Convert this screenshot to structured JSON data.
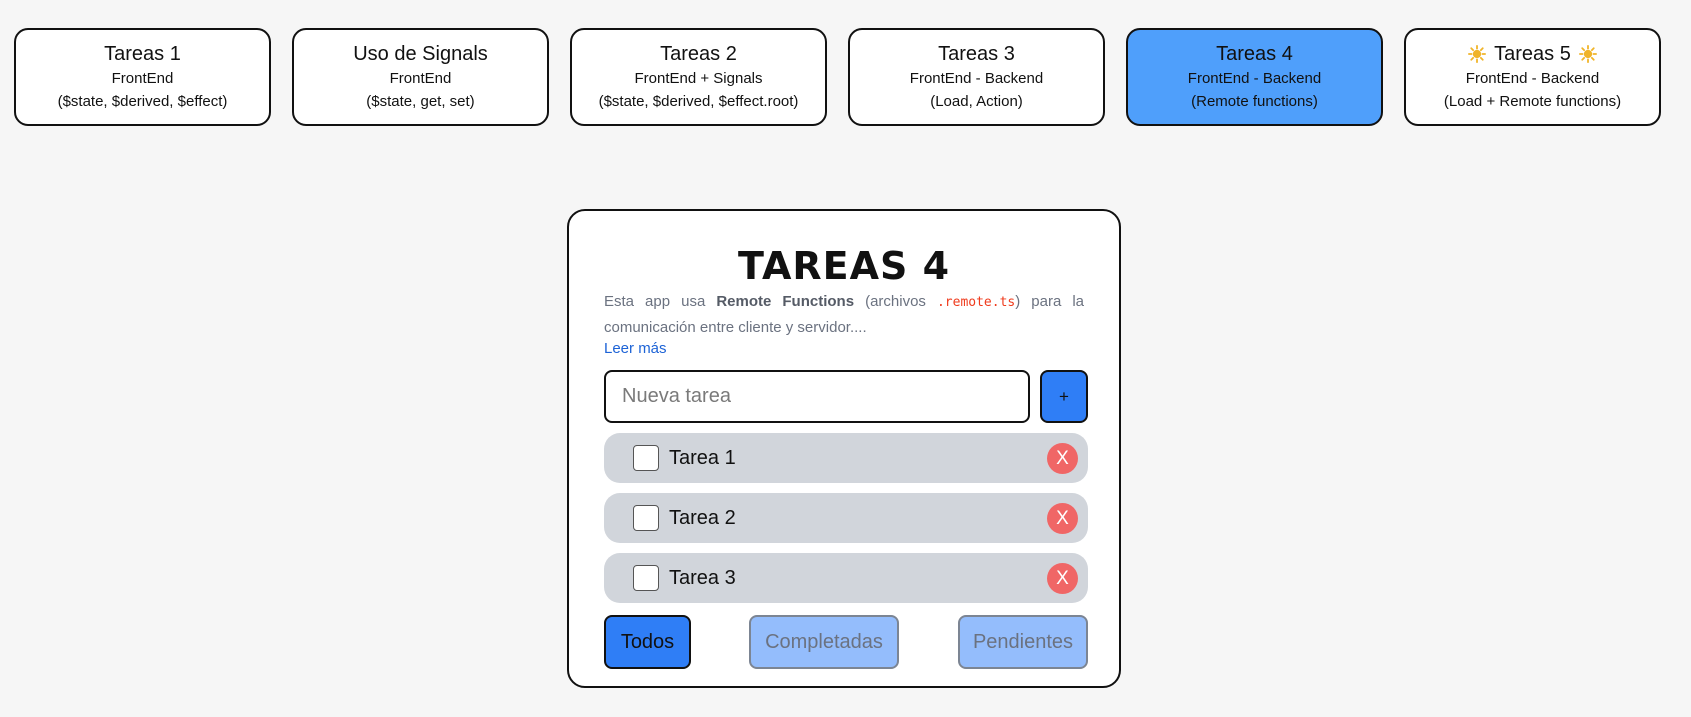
{
  "nav": {
    "cards": [
      {
        "title": "Tareas 1",
        "line1": "FrontEnd",
        "line2": "($state, $derived, $effect)"
      },
      {
        "title": "Uso de Signals",
        "line1": "FrontEnd",
        "line2": "($state, get, set)"
      },
      {
        "title": "Tareas 2",
        "line1": "FrontEnd + Signals",
        "line2": "($state, $derived, $effect.root)"
      },
      {
        "title": "Tareas 3",
        "line1": "FrontEnd - Backend",
        "line2": "(Load, Action)"
      },
      {
        "title": "Tareas 4",
        "line1": "FrontEnd - Backend",
        "line2": "(Remote functions)"
      },
      {
        "title": "Tareas 5",
        "line1": "FrontEnd - Backend",
        "line2": "(Load + Remote functions)"
      }
    ],
    "active_index": 4,
    "accent_color": "#4f9ffb",
    "sun_icon": "sun-icon",
    "sun_color": "#f0b429"
  },
  "panel": {
    "title": "TAREAS 4",
    "description": {
      "part1": "Esta app usa ",
      "bold": "Remote Functions",
      "part2": " (archivos ",
      "code": ".remote.ts",
      "part3": ") para la comunicación entre cliente y servidor...."
    },
    "read_more": "Leer más",
    "input": {
      "value": "",
      "placeholder": "Nueva tarea"
    },
    "add_label": "+",
    "tasks": [
      {
        "label": "Tarea 1",
        "completed": false,
        "delete_label": "X"
      },
      {
        "label": "Tarea 2",
        "completed": false,
        "delete_label": "X"
      },
      {
        "label": "Tarea 3",
        "completed": false,
        "delete_label": "X"
      }
    ],
    "filters": {
      "all": "Todos",
      "completed": "Completadas",
      "pending": "Pendientes",
      "selected": "all"
    },
    "colors": {
      "primary_button": "#2f7ef6",
      "inactive_button": "#94bdfc",
      "task_background": "#d1d5db",
      "delete_button": "#f06666",
      "code_text": "#ef3b1d",
      "link": "#1d63d6"
    }
  }
}
